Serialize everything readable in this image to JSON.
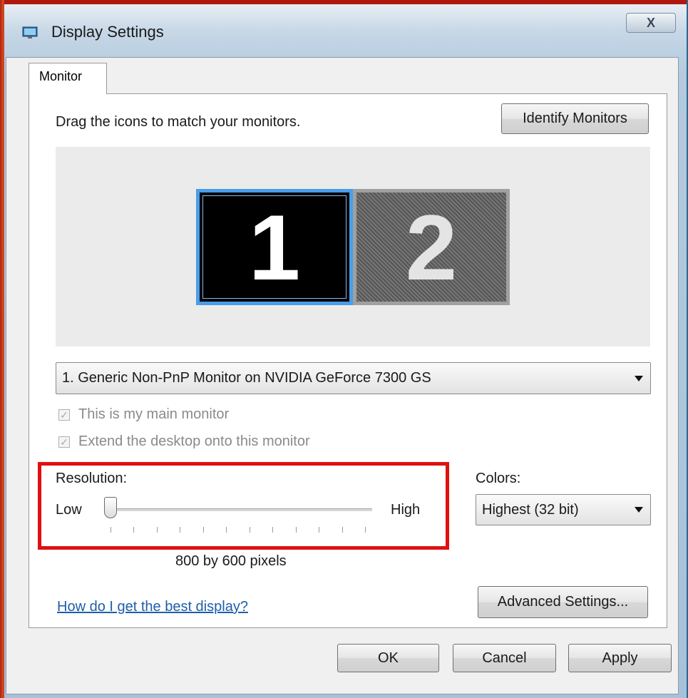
{
  "window": {
    "title": "Display Settings",
    "close_glyph": "X",
    "icon": "display-settings-icon"
  },
  "tabs": [
    {
      "label": "Monitor"
    }
  ],
  "monitors_panel": {
    "instruction": "Drag the icons to match your monitors.",
    "identify_button": "Identify Monitors",
    "monitors": [
      {
        "number": "1",
        "selected": true
      },
      {
        "number": "2",
        "selected": false
      }
    ]
  },
  "monitor_select": {
    "value": "1. Generic Non-PnP Monitor on NVIDIA GeForce 7300 GS"
  },
  "checkboxes": {
    "main_monitor": {
      "label": "This is my main monitor",
      "checked": true,
      "disabled": true
    },
    "extend_desktop": {
      "label": "Extend the desktop onto this monitor",
      "checked": true,
      "disabled": true
    }
  },
  "resolution": {
    "label": "Resolution:",
    "low_label": "Low",
    "high_label": "High",
    "value_text": "800 by 600 pixels",
    "slider_fraction": 0,
    "tick_count": 12
  },
  "colors": {
    "label": "Colors:",
    "value": "Highest (32 bit)"
  },
  "help_link": "How do I get the best display?",
  "advanced_button": "Advanced Settings...",
  "footer": {
    "ok": "OK",
    "cancel": "Cancel",
    "apply": "Apply"
  },
  "highlight_color": "#e01010",
  "accent_color": "#4a9de8"
}
